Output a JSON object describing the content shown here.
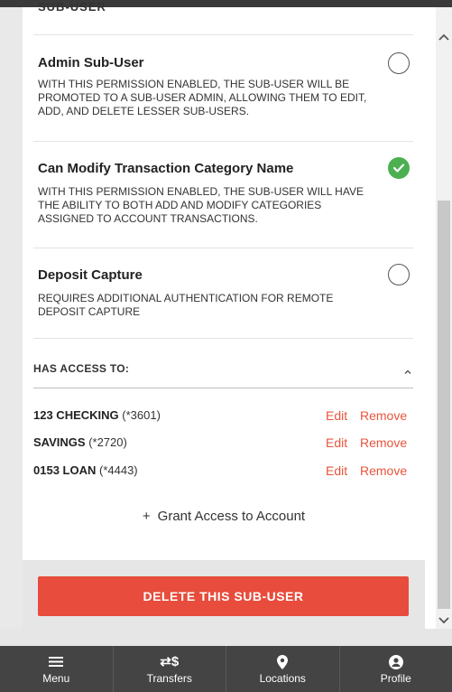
{
  "cut_heading": "SUB-USER",
  "permissions": [
    {
      "title": "Admin Sub-User",
      "description": "With this permission enabled, the sub-user will be promoted to a sub-user admin, allowing them to edit, add, and delete lesser sub-users.",
      "enabled": false
    },
    {
      "title": "Can Modify Transaction Category Name",
      "description": "With this permission enabled, the sub-user will have the ability to both add and modify categories assigned to account transactions.",
      "enabled": true
    },
    {
      "title": "Deposit Capture",
      "description": "Requires additional authentication for remote deposit capture",
      "enabled": false
    }
  ],
  "access": {
    "header": "HAS ACCESS TO:",
    "accounts": [
      {
        "name": "123 CHECKING",
        "number": "(*3601)",
        "edit": "Edit",
        "remove": "Remove"
      },
      {
        "name": "SAVINGS",
        "number": "(*2720)",
        "edit": "Edit",
        "remove": "Remove"
      },
      {
        "name": "0153 LOAN",
        "number": "(*4443)",
        "edit": "Edit",
        "remove": "Remove"
      }
    ],
    "grant_plus": "+",
    "grant_label": "Grant Access to Account"
  },
  "delete_label": "DELETE THIS SUB-USER",
  "nav": [
    {
      "label": "Menu",
      "icon": "menu-icon"
    },
    {
      "label": "Transfers",
      "icon": "transfers-icon"
    },
    {
      "label": "Locations",
      "icon": "location-pin-icon"
    },
    {
      "label": "Profile",
      "icon": "profile-icon"
    }
  ],
  "colors": {
    "accent_red": "#e74c3c",
    "link_red": "#e8553c",
    "check_green": "#4caf50",
    "nav_bg": "#444444"
  }
}
